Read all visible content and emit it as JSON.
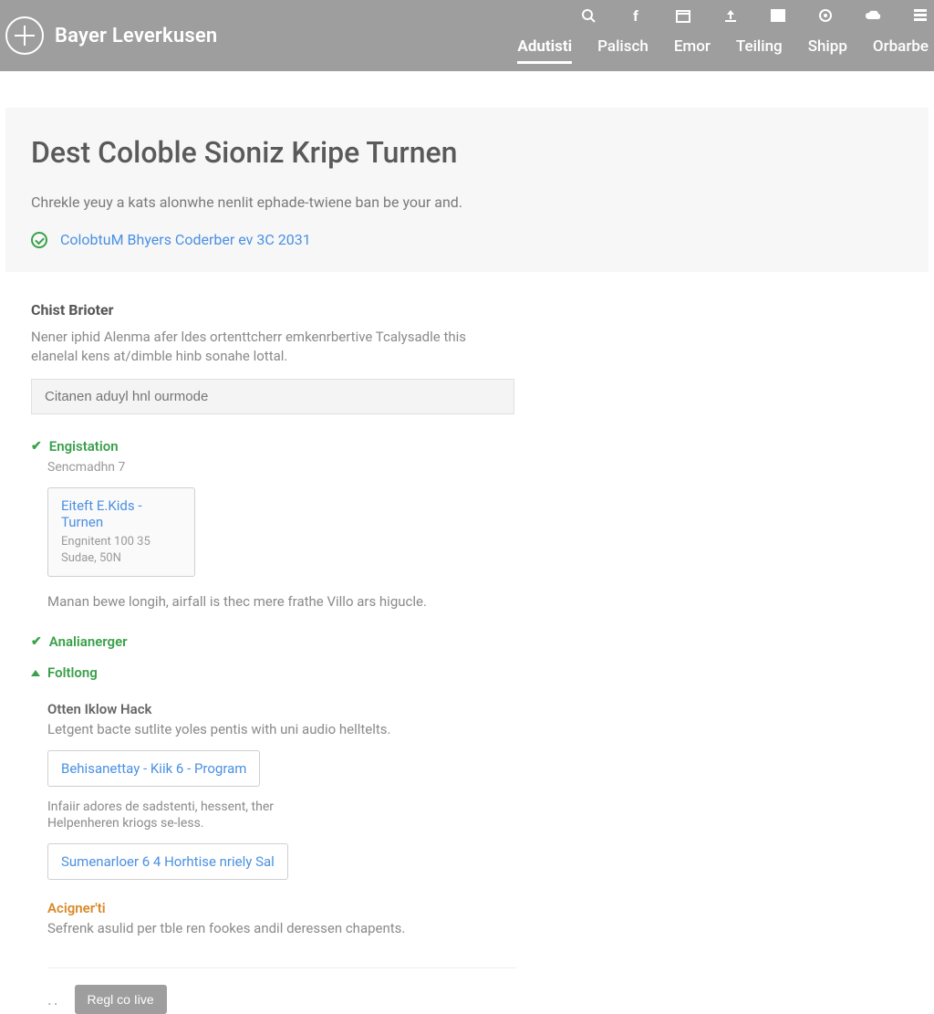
{
  "brand": {
    "name": "Bayer Leverkusen"
  },
  "nav": {
    "items": [
      {
        "label": "Adutisti",
        "active": true
      },
      {
        "label": "Palisch"
      },
      {
        "label": "Emor"
      },
      {
        "label": "Teiling"
      },
      {
        "label": "Shipp"
      },
      {
        "label": "Orbarbe"
      }
    ]
  },
  "hero": {
    "title": "Dest Coloble Sioniz Kripe Turnen",
    "subtitle": "Chrekle yeuy a kats alonwhe nenlit ephade-twiene ban be your and.",
    "link": "ColobtuM Bhyers Coderber ev 3C 2031"
  },
  "section1": {
    "title": "Chist Brioter",
    "body": "Nener iphid Alenma afer ldes ortenttcherr emkenrbertive Tcalysadle this elanelal kens at/dimble hinb sonahe lottal.",
    "input_placeholder": "Citanen aduyl hnl ourmode"
  },
  "acc1": {
    "label": "Engistation",
    "sub": "Sencmadhn 7",
    "card": {
      "title": "Eiteft E.Kids -Turnen",
      "line1": "Engnitent 100 35",
      "line2": "Sudae, 50N"
    },
    "note": "Manan bewe longih, airfall is thec mere frathe Villo ars higucle."
  },
  "acc2": {
    "label": "Analianerger"
  },
  "acc3": {
    "label": "Foltlong",
    "sub_head": "Otten Iklow Hack",
    "sub_body": "Letgent bacte sutlite yoles pentis with uni audio helltelts.",
    "pill1": "Behisanettay - Kiik 6 - Program",
    "desc1": "Infaiir adores de sadstenti, hessent, ther",
    "desc2": "Helpenheren kriogs se-less.",
    "pill2": "Sumenarloer 6  4 Horhtise nriely Sal",
    "acignerti_title": "Acigner'ti",
    "acignerti_body": "Sefrenk asulid per tble ren fookes andil deressen chapents."
  },
  "footer": {
    "button": "Regl co Iive"
  }
}
